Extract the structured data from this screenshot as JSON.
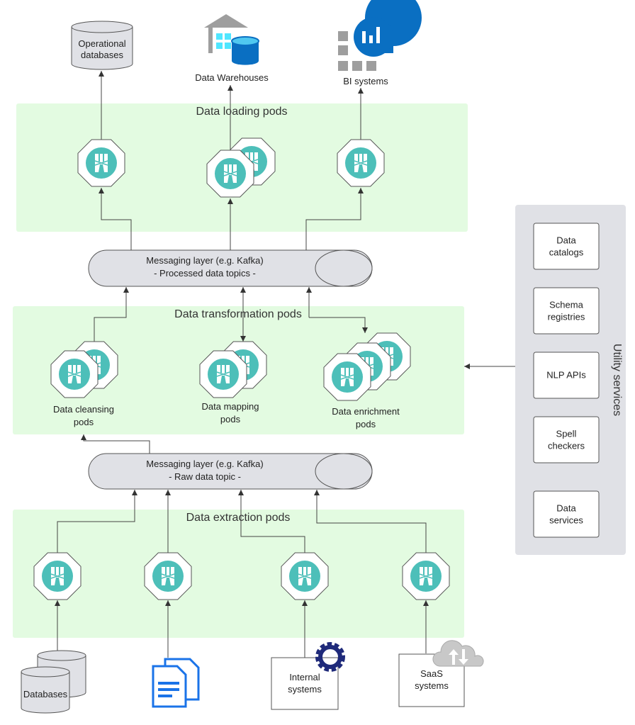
{
  "targets": {
    "operational_databases": [
      "Operational",
      "databases"
    ],
    "data_warehouses": "Data Warehouses",
    "bi_systems": "BI systems"
  },
  "zones": {
    "loading": "Data loading pods",
    "transformation": "Data transformation pods",
    "extraction": "Data extraction pods"
  },
  "messaging": {
    "processed": [
      "Messaging layer (e.g. Kafka)",
      "- Processed data topics -"
    ],
    "raw": [
      "Messaging layer (e.g. Kafka)",
      "- Raw data topic -"
    ]
  },
  "transform_groups": {
    "cleansing": [
      "Data cleansing",
      "pods"
    ],
    "mapping": [
      "Data mapping",
      "pods"
    ],
    "enrichment": [
      "Data enrichment",
      "pods"
    ]
  },
  "sources": {
    "databases": "Databases",
    "internal": [
      "Internal",
      "systems"
    ],
    "saas": [
      "SaaS",
      "systems"
    ]
  },
  "utility": {
    "title": "Utility services",
    "items": [
      [
        "Data",
        "catalogs"
      ],
      [
        "Schema",
        "registries"
      ],
      [
        "NLP APIs"
      ],
      [
        "Spell",
        "checkers"
      ],
      [
        "Data",
        "services"
      ]
    ]
  },
  "colors": {
    "zone": "#e3fbe1",
    "pod": "#4dbfb9",
    "messaging": "#e0e1e6",
    "utility": "#e0e1e6",
    "azure_blue": "#0a6fc2",
    "gear": "#1f2a7a"
  },
  "icons": [
    "pod-icon",
    "cylinder-database-icon",
    "warehouse-icon",
    "bi-icon",
    "document-icon",
    "gear-icon",
    "cloud-upload-download-icon"
  ]
}
